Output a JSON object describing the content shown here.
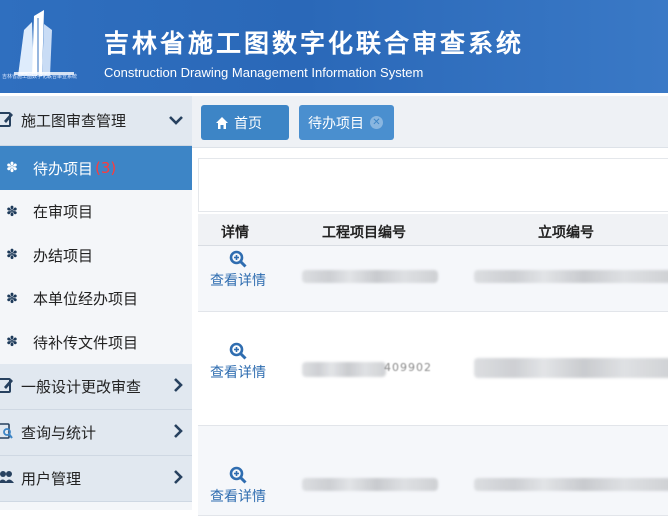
{
  "header": {
    "title_cn": "吉林省施工图数字化联合审查系统",
    "title_en": "Construction Drawing Management Information System",
    "logo_caption": "吉林省施工图数字化联合审查系统"
  },
  "sidebar": {
    "groups": [
      {
        "label": "施工图审查管理",
        "icon": "edit-icon",
        "chevron": "chevron-down-icon"
      },
      {
        "label": "一般设计更改审查",
        "icon": "edit-icon",
        "chevron": "chevron-right-icon"
      },
      {
        "label": "查询与统计",
        "icon": "search-icon",
        "chevron": "chevron-right-icon"
      },
      {
        "label": "用户管理",
        "icon": "users-icon",
        "chevron": "chevron-right-icon"
      }
    ],
    "items": [
      {
        "label": "待办项目",
        "count": "(3)",
        "icon": "yelp-icon",
        "active": true
      },
      {
        "label": "在审项目",
        "icon": "yelp-icon"
      },
      {
        "label": "办结项目",
        "icon": "yelp-icon"
      },
      {
        "label": "本单位经办项目",
        "icon": "yelp-icon"
      },
      {
        "label": "待补传文件项目",
        "icon": "yelp-icon"
      }
    ]
  },
  "tabs": [
    {
      "label": "首页",
      "icon": "home-icon"
    },
    {
      "label": "待办项目",
      "icon": "close-icon"
    }
  ],
  "table": {
    "columns": [
      "详情",
      "工程项目编号",
      "立项编号"
    ],
    "rows": [
      {
        "detail": "查看详情",
        "project_code": "",
        "approval_code": ""
      },
      {
        "detail": "查看详情",
        "project_code": "409902",
        "approval_code": ""
      },
      {
        "detail": "查看详情",
        "project_code": "",
        "approval_code": ""
      }
    ]
  },
  "colors": {
    "header_bg": "#2f6fbf",
    "active_item": "#3d85c6",
    "link": "#2f6db0",
    "count_red": "#e02020"
  }
}
